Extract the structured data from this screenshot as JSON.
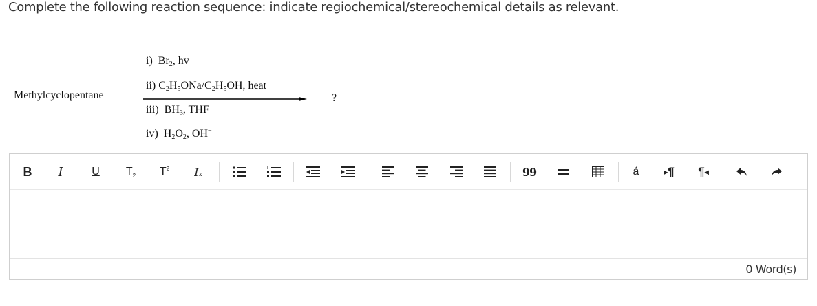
{
  "question": {
    "text": "Complete the following reaction sequence: indicate regiochemical/stereochemical details as relevant."
  },
  "reaction": {
    "reactant": "Methylcyclopentane",
    "product": "?",
    "reagents": {
      "step1": {
        "label": "i)",
        "a": "Br",
        "a_sub": "2",
        "b": ", hv"
      },
      "step2": {
        "label": "ii)",
        "a": "C",
        "a_sub": "2",
        "b": "H",
        "b_sub": "5",
        "c": "ONa/C",
        "c_sub": "2",
        "d": "H",
        "d_sub": "5",
        "e": "OH, heat"
      },
      "step3": {
        "label": "iii)",
        "a": "BH",
        "a_sub": "3",
        "b": ", THF"
      },
      "step4": {
        "label": "iv)",
        "a": "H",
        "a_sub": "2",
        "b": "O",
        "b_sub": "2",
        "c": ", OH",
        "c_sup": "−"
      }
    }
  },
  "editor": {
    "toolbar": [
      "bold-icon",
      "italic-icon",
      "underline-icon",
      "subscript-icon",
      "superscript-icon",
      "clear-formatting-icon",
      "bullet-list-icon",
      "numbered-list-icon",
      "outdent-icon",
      "indent-icon",
      "align-left-icon",
      "align-center-icon",
      "align-right-icon",
      "align-justify-icon",
      "blockquote-icon",
      "horizontal-rule-icon",
      "table-icon",
      "special-character-icon",
      "ltr-icon",
      "rtl-icon",
      "undo-icon",
      "redo-icon"
    ],
    "labels": {
      "bold": "B",
      "italic": "I",
      "underline": "U",
      "subscript": "T",
      "subscript_mark": "2",
      "superscript": "T",
      "superscript_mark": "2",
      "clear": "I",
      "clear_mark": "x",
      "quote": "99",
      "special_char": "á",
      "ltr": "¶",
      "rtl": "¶"
    },
    "content": "",
    "word_count": "0 Word(s)"
  }
}
